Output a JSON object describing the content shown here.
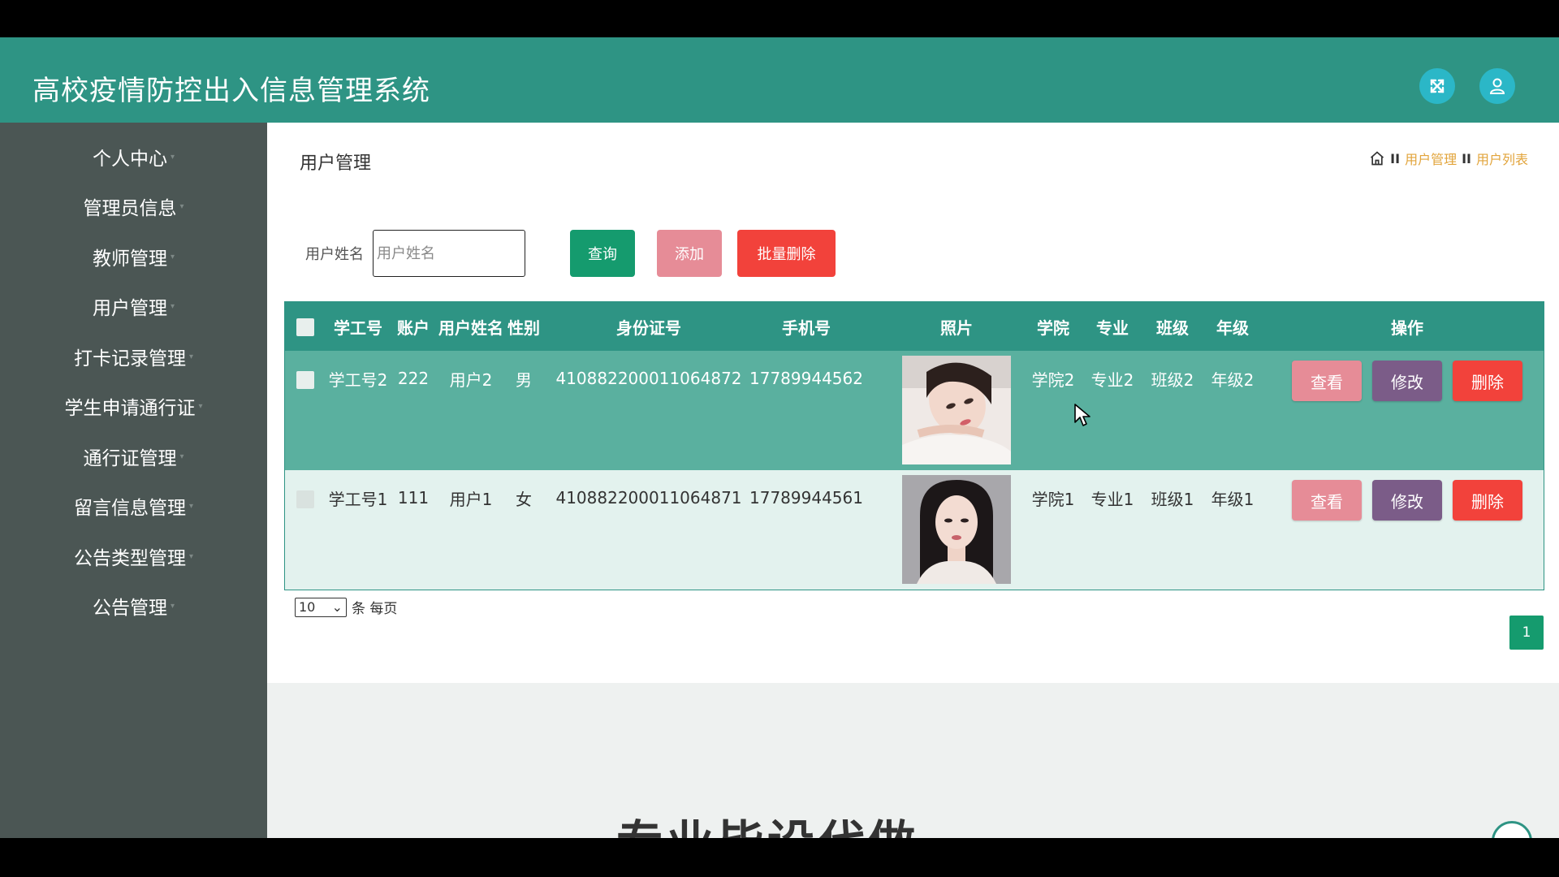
{
  "app": {
    "title": "高校疫情防控出入信息管理系统",
    "header_icons": [
      "expand-icon",
      "user-icon"
    ],
    "accent_color": "#2e9484"
  },
  "sidebar": {
    "items": [
      {
        "label": "个人中心"
      },
      {
        "label": "管理员信息"
      },
      {
        "label": "教师管理"
      },
      {
        "label": "用户管理"
      },
      {
        "label": "打卡记录管理"
      },
      {
        "label": "学生申请通行证"
      },
      {
        "label": "通行证管理"
      },
      {
        "label": "留言信息管理"
      },
      {
        "label": "公告类型管理"
      },
      {
        "label": "公告管理"
      }
    ]
  },
  "page": {
    "title": "用户管理",
    "breadcrumb": [
      "用户管理",
      "用户列表"
    ],
    "breadcrumb_sep": "II"
  },
  "search": {
    "label": "用户姓名",
    "placeholder": "用户姓名",
    "value": "",
    "query_label": "查询",
    "add_label": "添加",
    "batch_delete_label": "批量删除"
  },
  "table": {
    "headers": [
      "学工号",
      "账户",
      "用户姓名",
      "性别",
      "身份证号",
      "手机号",
      "照片",
      "学院",
      "专业",
      "班级",
      "年级",
      "操作"
    ],
    "rows": [
      {
        "student_id": "学工号2",
        "account": "222",
        "name": "用户2",
        "gender": "男",
        "id_card": "410882200011064872",
        "phone": "17789944562",
        "college": "学院2",
        "major": "专业2",
        "class": "班级2",
        "grade": "年级2"
      },
      {
        "student_id": "学工号1",
        "account": "111",
        "name": "用户1",
        "gender": "女",
        "id_card": "410882200011064871",
        "phone": "17789944561",
        "college": "学院1",
        "major": "专业1",
        "class": "班级1",
        "grade": "年级1"
      }
    ],
    "actions": {
      "view": "查看",
      "edit": "修改",
      "delete": "删除"
    }
  },
  "pagination": {
    "page_size": "10",
    "per_page_label": "条 每页",
    "current_page": "1"
  },
  "footer_banner_text": "专业毕设代做"
}
